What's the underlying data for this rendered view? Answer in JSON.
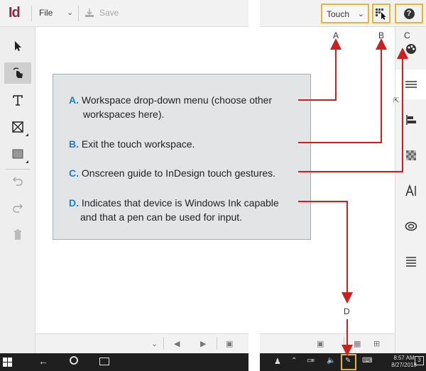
{
  "app": {
    "logo": "Id"
  },
  "toolbar": {
    "file_label": "File",
    "save_label": "Save"
  },
  "workspace": {
    "touch_label": "Touch"
  },
  "callout": {
    "items": [
      {
        "letter": "A.",
        "text": "Workspace drop-down menu (choose other",
        "text2": "workspaces here)."
      },
      {
        "letter": "B.",
        "text": "Exit the touch workspace."
      },
      {
        "letter": "C.",
        "text": "Onscreen guide to InDesign touch gestures."
      },
      {
        "letter": "D.",
        "text": "Indicates that device is Windows Ink capable",
        "text2": "and that a pen can be used for input."
      }
    ]
  },
  "labels": {
    "a": "A",
    "b": "B",
    "c": "C",
    "d": "D"
  },
  "taskbar": {
    "time": "8:57 AM",
    "date": "8/27/2018",
    "notifications": "3"
  },
  "colors": {
    "accent": "#e8b633",
    "arrow": "#c8211f",
    "letter": "#1f7fc4",
    "logo": "#8a2a4a"
  },
  "icons": [
    "select-icon",
    "touch-hand-icon",
    "text-icon",
    "frame-icon",
    "rectangle-icon",
    "undo-icon",
    "redo-icon",
    "delete-icon",
    "swatches-icon",
    "paragraph-icon",
    "align-icon",
    "gradient-icon",
    "character-icon",
    "cc-libraries-icon",
    "stroke-icon",
    "help-icon"
  ]
}
